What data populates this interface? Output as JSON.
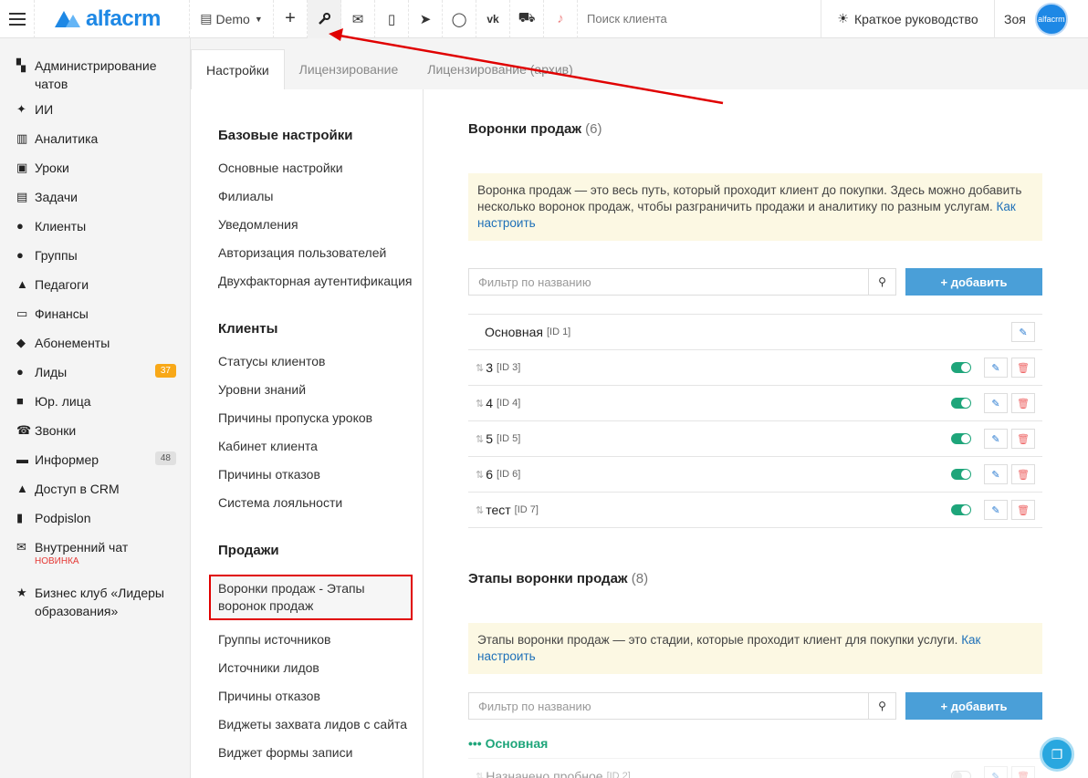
{
  "topbar": {
    "logo": "alfacrm",
    "demo": "Demo",
    "search_placeholder": "Поиск клиента",
    "guide": "Краткое руководство",
    "user": "Зоя",
    "avatar": "alfacrm"
  },
  "sidebar": {
    "items": [
      {
        "icon": "chat-admin-icon",
        "glyph": "▚",
        "label": "Администрирование чатов"
      },
      {
        "icon": "ai-icon",
        "glyph": "✦",
        "label": "ИИ"
      },
      {
        "icon": "map-icon",
        "glyph": "▥",
        "label": "Аналитика"
      },
      {
        "icon": "calendar-icon",
        "glyph": "▣",
        "label": "Уроки"
      },
      {
        "icon": "tasks-icon",
        "glyph": "▤",
        "label": "Задачи"
      },
      {
        "icon": "user-icon",
        "glyph": "●",
        "label": "Клиенты"
      },
      {
        "icon": "group-icon",
        "glyph": "●",
        "label": "Группы"
      },
      {
        "icon": "teacher-icon",
        "glyph": "▲",
        "label": "Педагоги"
      },
      {
        "icon": "money-icon",
        "glyph": "▭",
        "label": "Финансы"
      },
      {
        "icon": "tag-icon",
        "glyph": "◆",
        "label": "Абонементы"
      },
      {
        "icon": "lead-icon",
        "glyph": "●",
        "label": "Лиды",
        "badge": "37"
      },
      {
        "icon": "briefcase-icon",
        "glyph": "■",
        "label": "Юр. лица"
      },
      {
        "icon": "phone-icon",
        "glyph": "☎",
        "label": "Звонки"
      },
      {
        "icon": "informer-icon",
        "glyph": "▬",
        "label": "Информер",
        "badge": "48"
      },
      {
        "icon": "lock-icon",
        "glyph": "▲",
        "label": "Доступ в CRM"
      },
      {
        "icon": "doc-icon",
        "glyph": "▮",
        "label": "Podpislon"
      },
      {
        "icon": "mail-icon",
        "glyph": "✉",
        "label": "Внутренний чат",
        "tag": "НОВИНКА"
      },
      {
        "icon": "star-icon",
        "glyph": "★",
        "label": "Бизнес клуб «Лидеры образования»"
      }
    ]
  },
  "tabs": [
    "Настройки",
    "Лицензирование",
    "Лицензирование (архив)"
  ],
  "settings_nav": {
    "sections": [
      {
        "title": "Базовые настройки",
        "links": [
          "Основные настройки",
          "Филиалы",
          "Уведомления",
          "Авторизация пользователей",
          "Двухфакторная аутентификация"
        ]
      },
      {
        "title": "Клиенты",
        "links": [
          "Статусы клиентов",
          "Уровни знаний",
          "Причины пропуска уроков",
          "Кабинет клиента",
          "Причины отказов",
          "Система лояльности"
        ]
      },
      {
        "title": "Продажи",
        "links": [
          "Воронки продаж - Этапы воронок продаж",
          "Группы источников",
          "Источники лидов",
          "Причины отказов",
          "Виджеты захвата лидов с сайта",
          "Виджет формы записи"
        ]
      }
    ]
  },
  "funnels": {
    "title": "Воронки продаж",
    "count": "(6)",
    "info": "Воронка продаж — это весь путь, который проходит клиент до покупки. Здесь можно добавить несколько воронок продаж, чтобы разграничить продажи и аналитику по разным услугам.",
    "info_link": "Как настроить",
    "filter_placeholder": "Фильтр по названию",
    "add_label": "добавить",
    "rows": [
      {
        "name": "Основная",
        "id": "[ID 1]"
      },
      {
        "name": "3",
        "id": "[ID 3]"
      },
      {
        "name": "4",
        "id": "[ID 4]"
      },
      {
        "name": "5",
        "id": "[ID 5]"
      },
      {
        "name": "6",
        "id": "[ID 6]"
      },
      {
        "name": "тест",
        "id": "[ID 7]"
      }
    ]
  },
  "stages": {
    "title": "Этапы воронки продаж",
    "count": "(8)",
    "info": "Этапы воронки продаж — это стадии, которые проходит клиент для покупки услуги.",
    "info_link": "Как настроить",
    "filter_placeholder": "Фильтр по названию",
    "add_label": "добавить",
    "group": "Основная",
    "rows": [
      {
        "name": "Назначено пробное",
        "id": "[ID 2]"
      }
    ]
  },
  "colors": {
    "accent": "#1e88e5",
    "button": "#4a9fd8",
    "toggle_on": "#1ea57a",
    "highlight_border": "#e00000",
    "arrow": "#e00000"
  }
}
